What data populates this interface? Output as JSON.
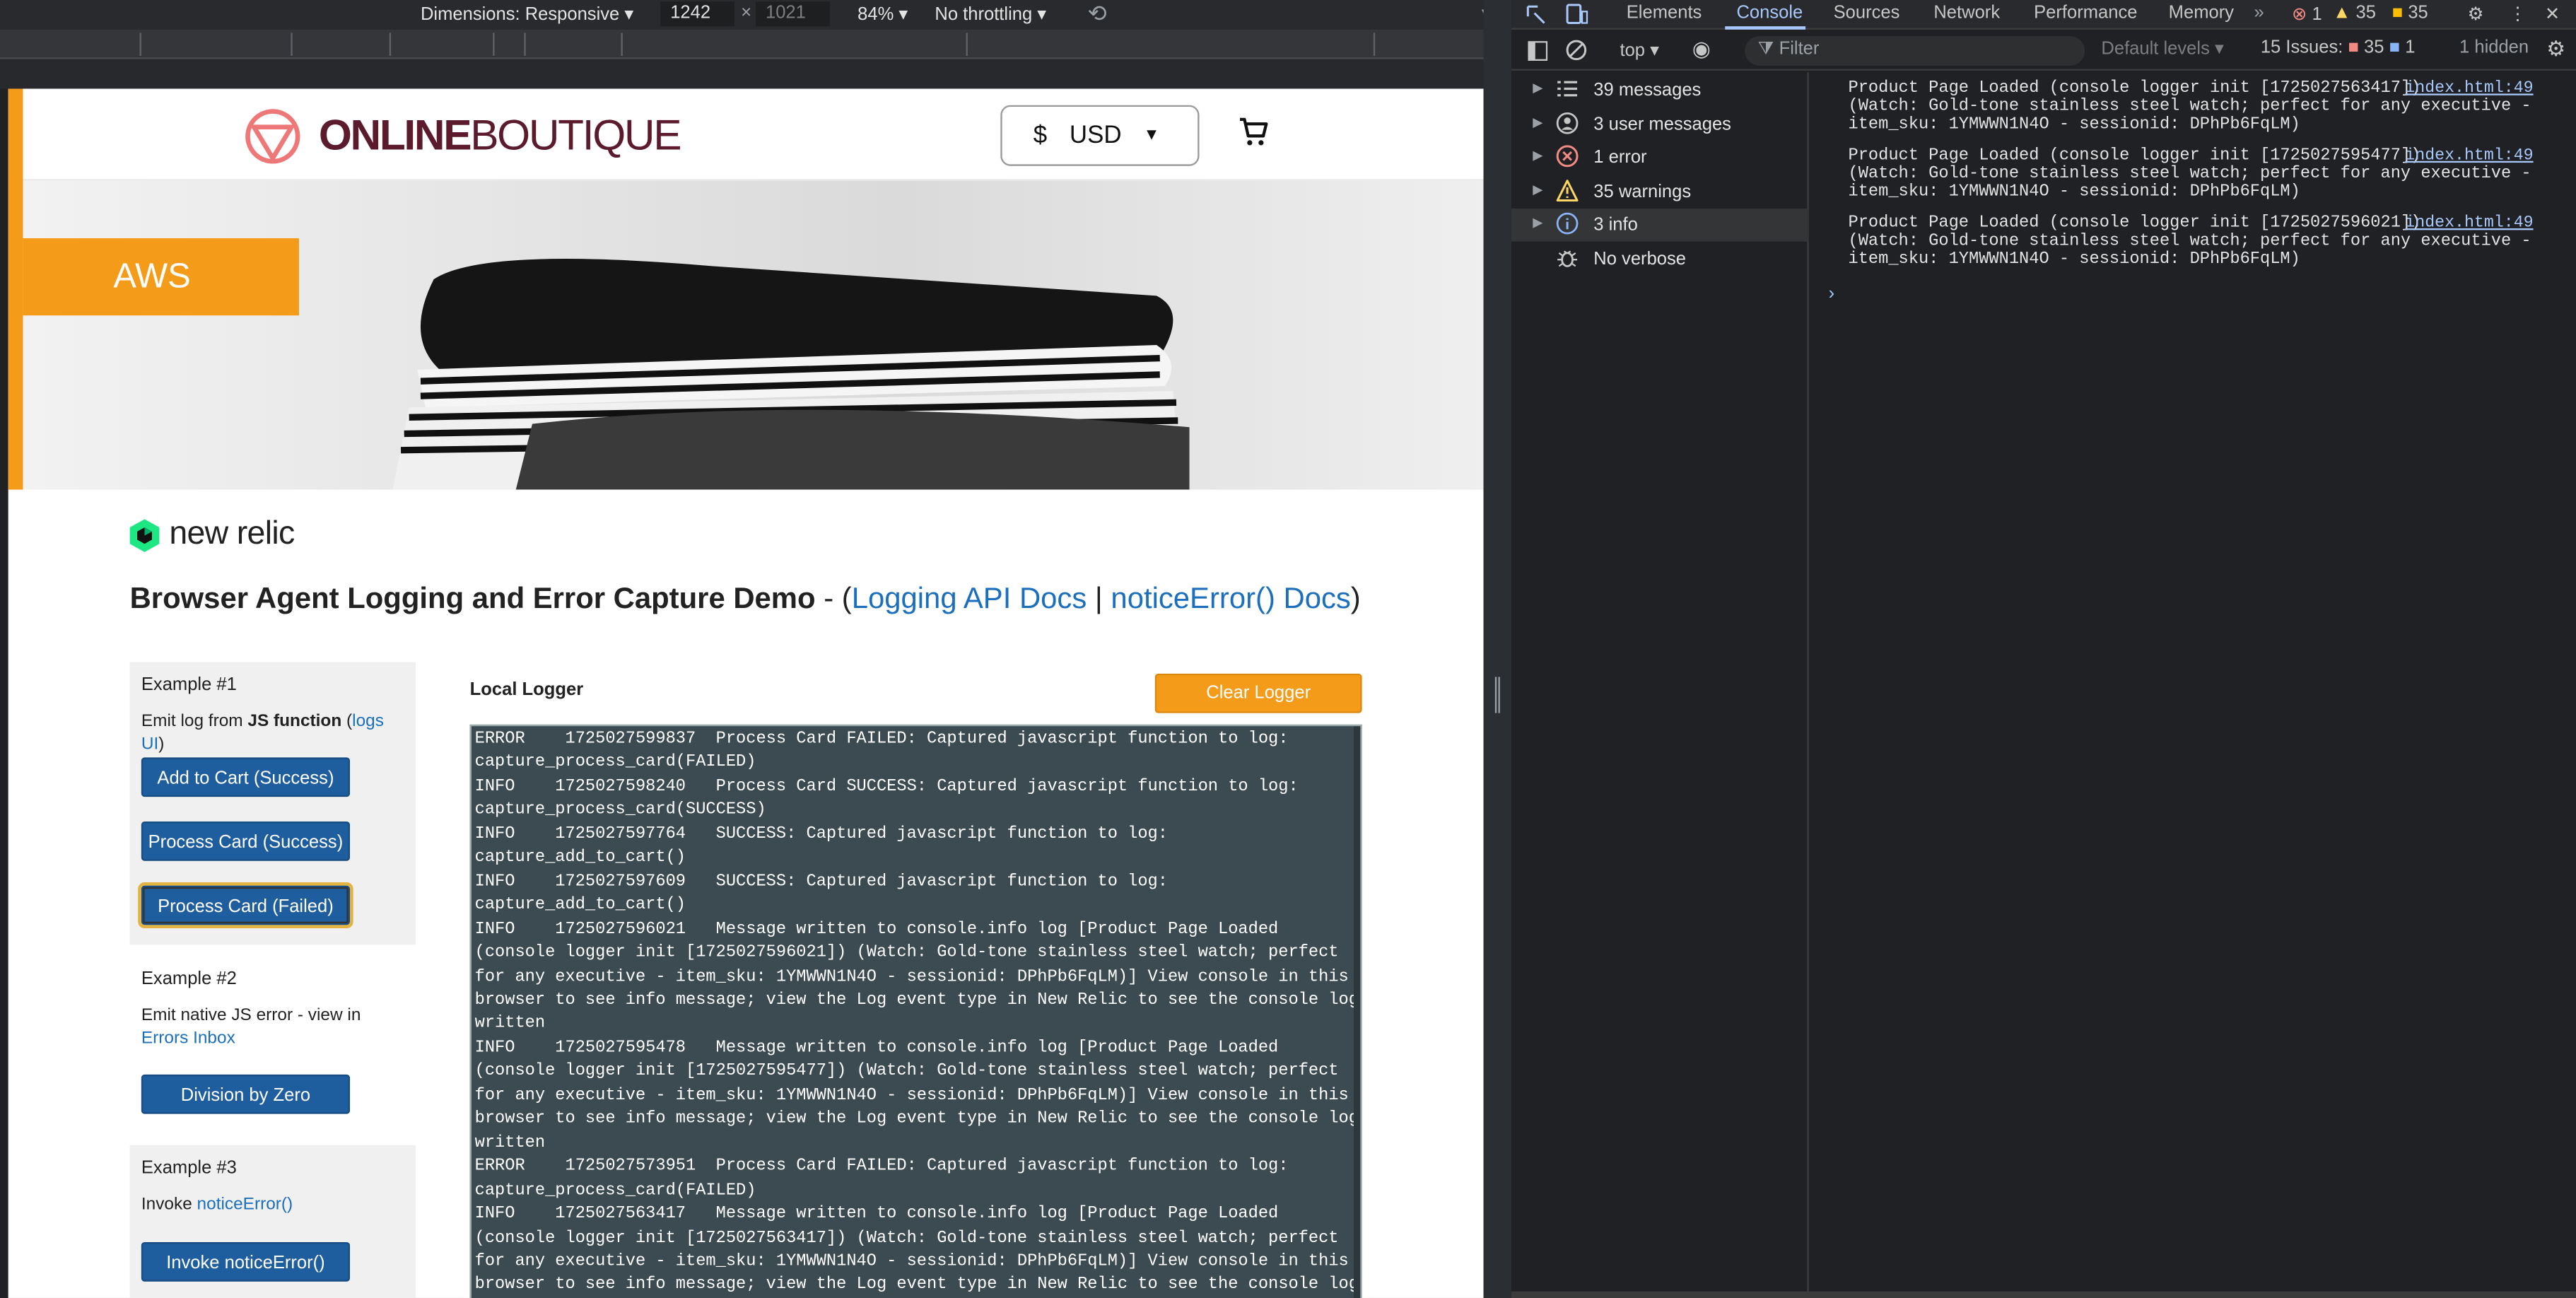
{
  "device_toolbar": {
    "dimensions_label": "Dimensions: Responsive",
    "width_value": "1242",
    "times": "×",
    "height_value": "1021",
    "zoom": "84%",
    "throttling": "No throttling"
  },
  "page": {
    "logo_bold": "ONLINE",
    "logo_light": "BOUTIQUE",
    "currency_symbol": "$",
    "currency_code": "USD",
    "hero_tag": "AWS",
    "brand": "new relic",
    "demo_title_bold": "Browser Agent Logging and Error Capture Demo",
    "demo_title_dash": " - (",
    "link_logging_api": "Logging API Docs",
    "link_sep": " | ",
    "link_notice_error": "noticeError() Docs",
    "demo_title_close": ")",
    "example1": {
      "title": "Example #1",
      "desc_pre": "Emit log from ",
      "desc_bold": "JS function",
      "desc_mid": " (",
      "desc_link": "logs UI",
      "desc_post": ")",
      "btn_add_cart": "Add to Cart (Success)",
      "btn_card_success": "Process Card (Success)",
      "btn_card_failed": "Process Card (Failed)"
    },
    "example2": {
      "title": "Example #2",
      "desc_pre": "Emit native JS error - view in ",
      "desc_link": "Errors Inbox",
      "btn": "Division by Zero"
    },
    "example3": {
      "title": "Example #3",
      "desc_pre": "Invoke ",
      "desc_link": "noticeError()",
      "btn": "Invoke noticeError()"
    },
    "local_logger_title": "Local Logger",
    "clear_logger": "Clear Logger",
    "log_lines": [
      "ERROR    1725027599837  Process Card FAILED: Captured javascript function to log:",
      "capture_process_card(FAILED)",
      "INFO    1725027598240   Process Card SUCCESS: Captured javascript function to log:",
      "capture_process_card(SUCCESS)",
      "INFO    1725027597764   SUCCESS: Captured javascript function to log:",
      "capture_add_to_cart()",
      "INFO    1725027597609   SUCCESS: Captured javascript function to log:",
      "capture_add_to_cart()",
      "INFO    1725027596021   Message written to console.info log [Product Page Loaded",
      "(console logger init [1725027596021]) (Watch: Gold-tone stainless steel watch; perfect",
      "for any executive - item_sku: 1YMWWN1N4O - sessionid: DPhPb6FqLM)] View console in this",
      "browser to see info message; view the Log event type in New Relic to see the console log",
      "written",
      "INFO    1725027595478   Message written to console.info log [Product Page Loaded",
      "(console logger init [1725027595477]) (Watch: Gold-tone stainless steel watch; perfect",
      "for any executive - item_sku: 1YMWWN1N4O - sessionid: DPhPb6FqLM)] View console in this",
      "browser to see info message; view the Log event type in New Relic to see the console log",
      "written",
      "ERROR    1725027573951  Process Card FAILED: Captured javascript function to log:",
      "capture_process_card(FAILED)",
      "INFO    1725027563417   Message written to console.info log [Product Page Loaded",
      "(console logger init [1725027563417]) (Watch: Gold-tone stainless steel watch; perfect",
      "for any executive - item_sku: 1YMWWN1N4O - sessionid: DPhPb6FqLM)] View console in this",
      "browser to see info message; view the Log event type in New Relic to see the console log"
    ]
  },
  "devtools": {
    "tabs": [
      "Elements",
      "Console",
      "Sources",
      "Network",
      "Performance",
      "Memory"
    ],
    "active_tab": "Console",
    "overflow": "»",
    "error_count": "1",
    "warning_count": "35",
    "issue_count": "35",
    "context": "top",
    "filter_placeholder": "Filter",
    "levels": "Default levels",
    "issues_label": "15 Issues:",
    "issues_warn": "35",
    "issues_info": "1",
    "hidden": "1 hidden",
    "sidebar": [
      {
        "label": "39 messages",
        "icon": "list-icon"
      },
      {
        "label": "3 user messages",
        "icon": "user-icon"
      },
      {
        "label": "1 error",
        "icon": "error-icon"
      },
      {
        "label": "35 warnings",
        "icon": "warning-icon"
      },
      {
        "label": "3 info",
        "icon": "info-icon"
      },
      {
        "label": "No verbose",
        "icon": "bug-icon"
      }
    ],
    "messages": [
      {
        "lines": [
          "Product Page Loaded (console logger init [1725027563417])",
          "(Watch: Gold-tone stainless steel watch; perfect for any executive -",
          "item_sku: 1YMWWN1N4O - sessionid: DPhPb6FqLM)"
        ],
        "source": "index.html:49"
      },
      {
        "lines": [
          "Product Page Loaded (console logger init [1725027595477])",
          "(Watch: Gold-tone stainless steel watch; perfect for any executive -",
          "item_sku: 1YMWWN1N4O - sessionid: DPhPb6FqLM)"
        ],
        "source": "index.html:49"
      },
      {
        "lines": [
          "Product Page Loaded (console logger init [1725027596021])",
          "(Watch: Gold-tone stainless steel watch; perfect for any executive -",
          "item_sku: 1YMWWN1N4O - sessionid: DPhPb6FqLM)"
        ],
        "source": "index.html:49"
      }
    ],
    "prompt_glyph": "›"
  },
  "colors": {
    "accent_orange": "#f49c1a",
    "link_blue": "#1b6fbd",
    "button_blue": "#1f5e9e",
    "devtools_bg": "#202124",
    "devtools_active": "#a8c7fa"
  }
}
